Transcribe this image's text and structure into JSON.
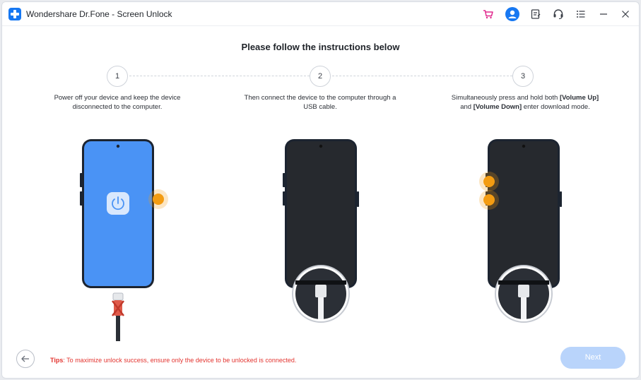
{
  "app": {
    "title": "Wondershare Dr.Fone - Screen Unlock"
  },
  "titlebar_icons": [
    "cart-icon",
    "user-avatar-icon",
    "notes-icon",
    "headset-icon",
    "menu-icon",
    "minimize-icon",
    "close-icon"
  ],
  "main": {
    "heading": "Please follow the instructions below"
  },
  "steps": [
    {
      "number": "1",
      "text": "Power off your device and keep the device disconnected to the computer."
    },
    {
      "number": "2",
      "text": "Then connect the device to the computer through a USB cable."
    },
    {
      "number": "3",
      "text_prefix": "Simultaneously press and hold both ",
      "bold1": "[Volume Up]",
      "text_mid": " and ",
      "bold2": "[Volume Down]",
      "text_suffix": " enter download mode."
    }
  ],
  "footer": {
    "tips_label": "Tips",
    "tips_text": ": To maximize unlock success, ensure only the device to be unlocked is connected.",
    "next_label": "Next"
  },
  "colors": {
    "accent": "#1778f2",
    "phone_screen_on": "#4a93f5",
    "highlight": "#f39c12",
    "tips": "#e3342f",
    "next_disabled": "#b9d4fb"
  }
}
